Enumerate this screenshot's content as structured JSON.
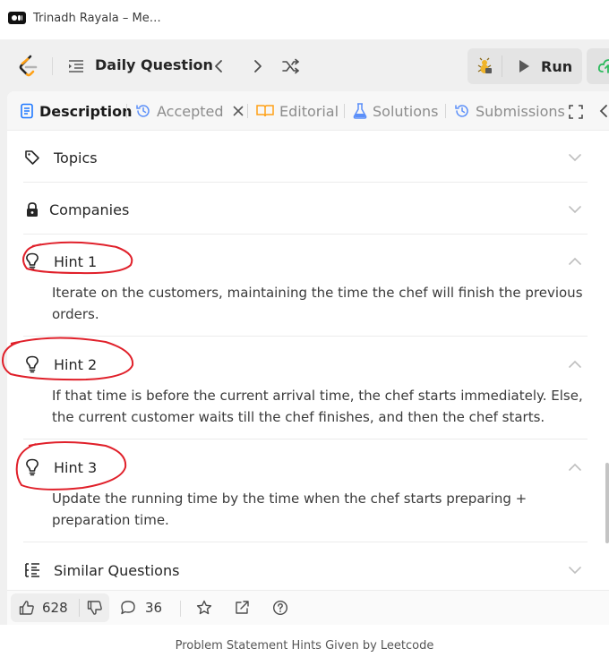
{
  "browser": {
    "tab_title": "Trinadh Rayala – Me…"
  },
  "toolbar": {
    "problem_list_label": "Daily Question",
    "run_label": "Run"
  },
  "tabs": [
    {
      "label": "Description",
      "active": true
    },
    {
      "label": "Accepted",
      "active": false
    },
    {
      "label": "Editorial",
      "active": false
    },
    {
      "label": "Solutions",
      "active": false
    },
    {
      "label": "Submissions",
      "active": false
    }
  ],
  "sections": {
    "topics": "Topics",
    "companies": "Companies",
    "similar": "Similar Questions"
  },
  "hints": [
    {
      "title": "Hint 1",
      "text": "Iterate on the customers, maintaining the time the chef will finish the previous orders."
    },
    {
      "title": "Hint 2",
      "text": "If that time is before the current arrival time, the chef starts immediately. Else, the current customer waits till the chef finishes, and then the chef starts."
    },
    {
      "title": "Hint 3",
      "text": "Update the running time by the time when the chef starts preparing + preparation time."
    }
  ],
  "footer": {
    "likes": "628",
    "comments": "36"
  },
  "caption": "Problem Statement Hints Given by Leetcode",
  "colors": {
    "accent": "#ffa116",
    "annotation": "#e0202a",
    "run_icon": "#595959"
  }
}
